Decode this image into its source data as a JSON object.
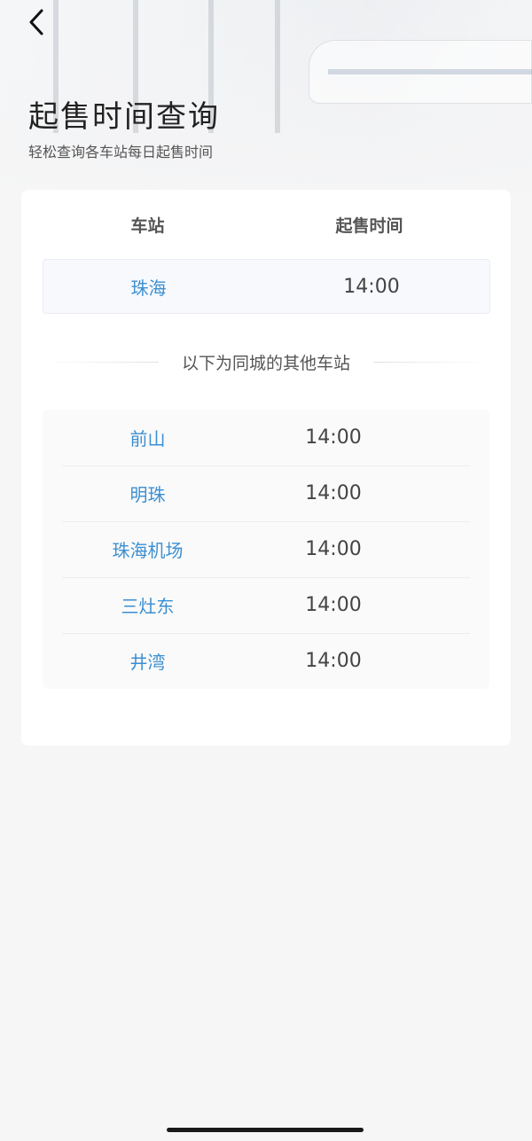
{
  "header": {
    "title": "起售时间查询",
    "subtitle": "轻松查询各车站每日起售时间"
  },
  "table": {
    "col_station": "车站",
    "col_time": "起售时间",
    "main": {
      "station": "珠海",
      "time": "14:00"
    }
  },
  "divider_text": "以下为同城的其他车站",
  "others": [
    {
      "station": "前山",
      "time": "14:00"
    },
    {
      "station": "明珠",
      "time": "14:00"
    },
    {
      "station": "珠海机场",
      "time": "14:00"
    },
    {
      "station": "三灶东",
      "time": "14:00"
    },
    {
      "station": "井湾",
      "time": "14:00"
    }
  ],
  "icons": {
    "back": "chevron-left-icon"
  },
  "colors": {
    "station_link": "#3c8fd1",
    "background": "#f6f6f7"
  }
}
